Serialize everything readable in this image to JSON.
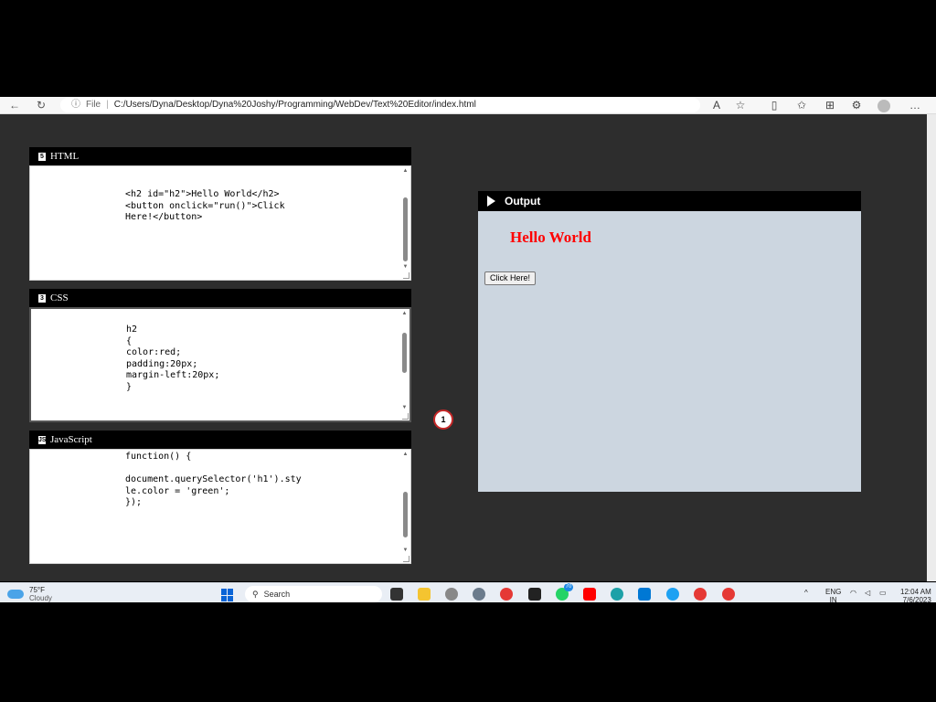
{
  "browser": {
    "back_icon": "←",
    "reload_icon": "↻",
    "info_icon": "ⓘ",
    "file_label": "File",
    "separator": "|",
    "url": "C:/Users/Dyna/Desktop/Dyna%20Joshy/Programming/WebDev/Text%20Editor/index.html",
    "read_aloud_icon": "A",
    "favorite_icon": "☆",
    "split_icon": "▯",
    "favorites_list_icon": "✩",
    "collections_icon": "⊞",
    "extensions_icon": "⚙",
    "more_icon": "…"
  },
  "panels": {
    "html": {
      "title": "HTML",
      "icon": "5",
      "code": "<h2 id=\"h2\">Hello World</h2>\n<button onclick=\"run()\">Click\nHere!</button>"
    },
    "css": {
      "title": "CSS",
      "icon": "3",
      "code": "h2\n{\ncolor:red;\npadding:20px;\nmargin-left:20px;\n}"
    },
    "js": {
      "title": "JavaScript",
      "icon": "JS",
      "code": "function() {\n\ndocument.querySelector('h1').sty\nle.color = 'green';\n});"
    }
  },
  "badge": "1",
  "output": {
    "title": "Output",
    "heading": "Hello World",
    "button_label": "Click Here!"
  },
  "taskbar": {
    "temperature": "75°F",
    "condition": "Cloudy",
    "search_placeholder": "Search",
    "notification_count": "70",
    "language": "ENG",
    "region": "IN",
    "time": "12:04 AM",
    "date": "7/6/2023"
  },
  "colors": {
    "page_bg": "#2d2d2d",
    "panel_header": "#000000",
    "output_bg": "#ccd6e0",
    "heading_red": "#ff0000"
  }
}
